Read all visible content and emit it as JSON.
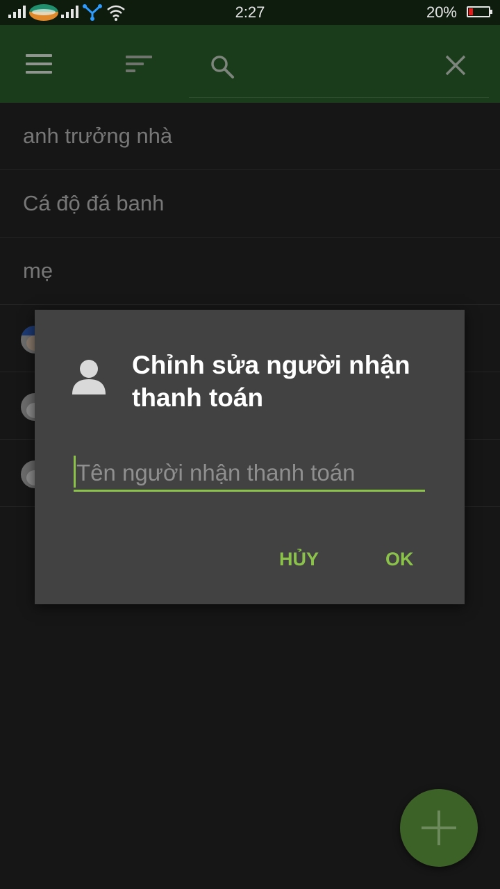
{
  "status_bar": {
    "time": "2:27",
    "battery_percent": "20%",
    "battery_level": 0.2,
    "icons": [
      "signal-icon",
      "carrier-logo-icon",
      "signal-icon",
      "network-share-icon",
      "wifi-icon",
      "battery-icon"
    ]
  },
  "app_bar": {
    "menu_icon": "menu-icon",
    "sort_icon": "sort-icon",
    "search_icon": "search-icon",
    "close_icon": "close-icon"
  },
  "list": {
    "items": [
      {
        "label": "anh trưởng nhà"
      },
      {
        "label": "Cá độ đá banh"
      },
      {
        "label": "mẹ"
      }
    ]
  },
  "dialog": {
    "icon": "person-icon",
    "title_line1": "Chỉnh sửa người nhận",
    "title_line2": "thanh toán",
    "input_value": "",
    "input_placeholder": "Tên người nhận thanh toán",
    "cancel_label": "HỦY",
    "ok_label": "OK"
  },
  "fab": {
    "icon": "plus-icon"
  },
  "colors": {
    "accent": "#8bc34a",
    "app_bar": "#1a3c1a",
    "dialog_bg": "#424242",
    "fab": "#3d6228",
    "background": "#161616"
  }
}
